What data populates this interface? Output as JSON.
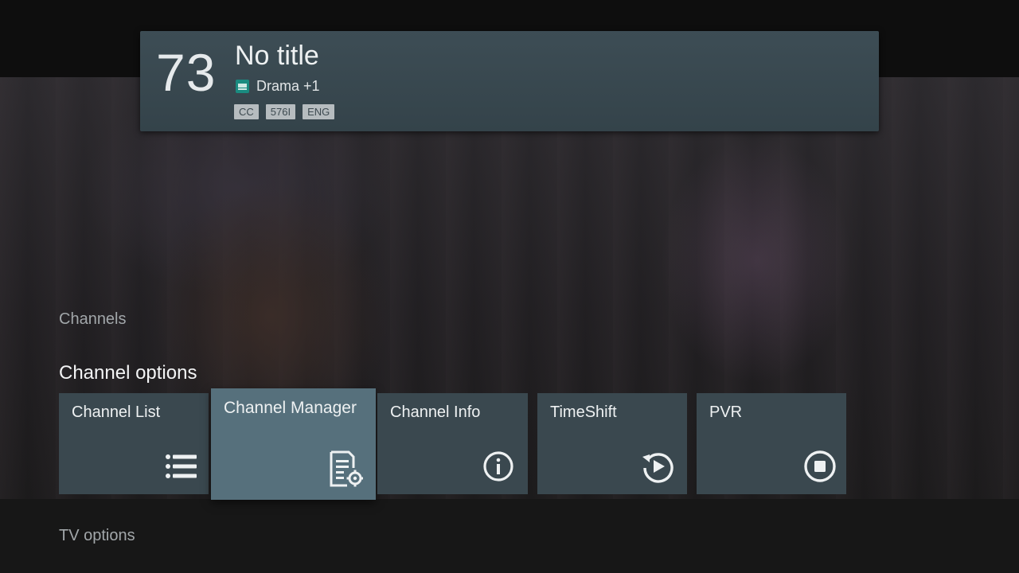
{
  "info_banner": {
    "channel_number": "73",
    "program_title": "No title",
    "channel_name": "Drama +1",
    "channel_logo_icon": "channel-logo-icon",
    "badges": [
      "CC",
      "576I",
      "ENG"
    ]
  },
  "sections": {
    "channels_label": "Channels",
    "channel_options_title": "Channel options",
    "tv_options_label": "TV options"
  },
  "channel_options": [
    {
      "label": "Channel List",
      "icon": "list-icon"
    },
    {
      "label": "Channel Manager",
      "icon": "document-settings-icon",
      "focused": true
    },
    {
      "label": "Channel Info",
      "icon": "info-icon"
    },
    {
      "label": "TimeShift",
      "icon": "replay-icon"
    },
    {
      "label": "PVR",
      "icon": "record-stop-icon"
    }
  ],
  "colors": {
    "banner_background": "#3a4a52",
    "card_background": "#3a484f",
    "card_focused_background": "#56707c",
    "channel_logo": "#1a8b80"
  }
}
